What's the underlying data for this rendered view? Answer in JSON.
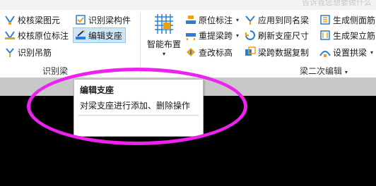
{
  "titlebar": {
    "right_text": "告诉我您想要做什么"
  },
  "group1": {
    "label": "识别梁",
    "buttons": [
      {
        "label": "校核梁图元",
        "icon": "beam-check-icon"
      },
      {
        "label": "识别梁构件",
        "icon": "beam-identify-icon"
      },
      {
        "label": "校核原位标注",
        "icon": "annotation-check-icon"
      },
      {
        "label": "编辑支座",
        "icon": "support-edit-icon",
        "selected": true
      },
      {
        "label": "识别吊筋",
        "icon": "hanger-identify-icon"
      }
    ]
  },
  "group2": {
    "label": "梁二次编辑",
    "big_button": {
      "label": "智能布置",
      "icon": "smart-layout-icon"
    },
    "buttons": [
      {
        "label": "原位标注",
        "icon": "in-situ-annotation-icon",
        "dropdown": true
      },
      {
        "label": "应用到同名梁",
        "icon": "apply-same-name-icon"
      },
      {
        "label": "生成侧面筋",
        "icon": "side-rebar-icon"
      },
      {
        "label": "重提梁跨",
        "icon": "beam-span-icon",
        "dropdown": true
      },
      {
        "label": "刷新支座尺寸",
        "icon": "refresh-support-icon"
      },
      {
        "label": "生成架立筋",
        "icon": "erection-rebar-icon"
      },
      {
        "label": "查改标高",
        "icon": "elevation-icon"
      },
      {
        "label": "梁跨数据复制",
        "icon": "span-copy-icon"
      },
      {
        "label": "设置拱梁",
        "icon": "arch-beam-icon",
        "dropdown": true
      }
    ]
  },
  "tooltip": {
    "title": "编辑支座",
    "description": "对梁支座进行添加、删除操作"
  },
  "colors": {
    "highlight": "#ee22ee",
    "selected_bg": "#cde6f7",
    "canvas": "#000000"
  }
}
